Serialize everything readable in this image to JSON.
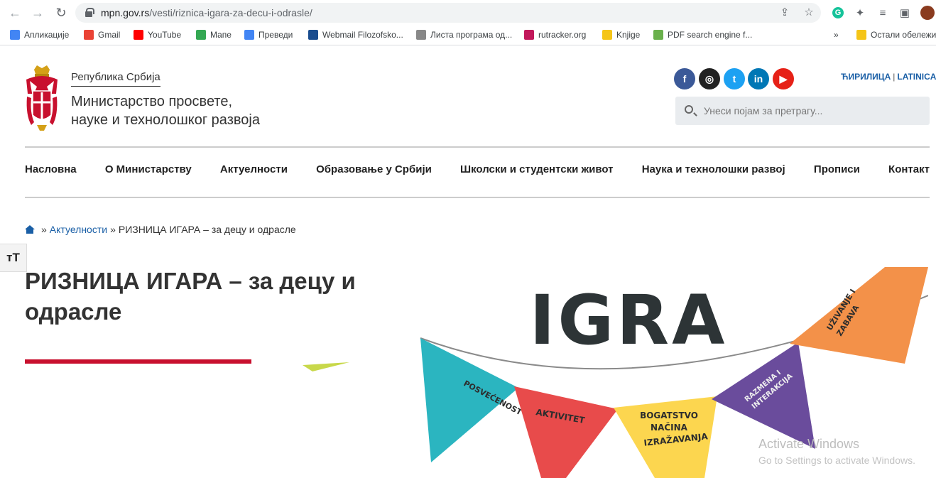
{
  "browser": {
    "url_host": "mpn.gov.rs",
    "url_path": "/vesti/riznica-igara-za-decu-i-odrasle/",
    "bookmarks": [
      {
        "label": "Апликације",
        "color": "#4285f4"
      },
      {
        "label": "Gmail",
        "color": "#ea4335"
      },
      {
        "label": "YouTube",
        "color": "#ff0000"
      },
      {
        "label": "Мапе",
        "color": "#34a853"
      },
      {
        "label": "Преведи",
        "color": "#4285f4"
      },
      {
        "label": "Webmail Filozofsko...",
        "color": "#1a4d8f"
      },
      {
        "label": "Листа програма од...",
        "color": "#888888"
      },
      {
        "label": "rutracker.org",
        "color": "#c2185b"
      },
      {
        "label": "Knjige",
        "color": "#f5c518"
      },
      {
        "label": "PDF search engine f...",
        "color": "#6ab04c"
      }
    ],
    "more_label": "»",
    "other_bookmarks": "Остали обележи"
  },
  "header": {
    "republic": "Република Србија",
    "ministry_line1": "Министарство просвете,",
    "ministry_line2": "науке и технолошког развоја",
    "lang_cyr": "ЋИРИЛИЦА",
    "lang_sep": "|",
    "lang_lat": "LATINICA",
    "search_placeholder": "Унеси појам за претрагу..."
  },
  "social": [
    {
      "name": "facebook-icon",
      "glyph": "f",
      "color": "#3b5998"
    },
    {
      "name": "instagram-icon",
      "glyph": "◎",
      "color": "#222222"
    },
    {
      "name": "twitter-icon",
      "glyph": "t",
      "color": "#1da1f2"
    },
    {
      "name": "linkedin-icon",
      "glyph": "in",
      "color": "#0077b5"
    },
    {
      "name": "youtube-icon",
      "glyph": "▶",
      "color": "#e62117"
    }
  ],
  "nav": {
    "items": [
      "Насловна",
      "О Министарству",
      "Актуелности",
      "Образовање у Србији",
      "Школски и студентски живот",
      "Наука и технолошки развој",
      "Прописи",
      "Контакт"
    ]
  },
  "breadcrumb": {
    "sep": "»",
    "section": "Актуелности",
    "current": "РИЗНИЦА ИГАРА – за децу и одрасле"
  },
  "font_toggle": "тT",
  "article": {
    "title": "РИЗНИЦА ИГАРА – за децу и одрасле"
  },
  "hero": {
    "word": "IGRA",
    "flags": [
      {
        "text": "POSVEĆENOST",
        "color": "#2bb5c0"
      },
      {
        "text": "AKTIVITET",
        "color": "#e84b4b"
      },
      {
        "text": "BOGATSTVO NAČINA IZRAŽAVANJA",
        "color": "#fcd64f"
      },
      {
        "text": "RAZMENA I INTERAKCIJA",
        "color": "#6a4c9c"
      },
      {
        "text": "UŽIVANJE I ZABAVA",
        "color": "#f39149"
      }
    ]
  },
  "watermark": {
    "line1": "Activate Windows",
    "line2": "Go to Settings to activate Windows."
  }
}
